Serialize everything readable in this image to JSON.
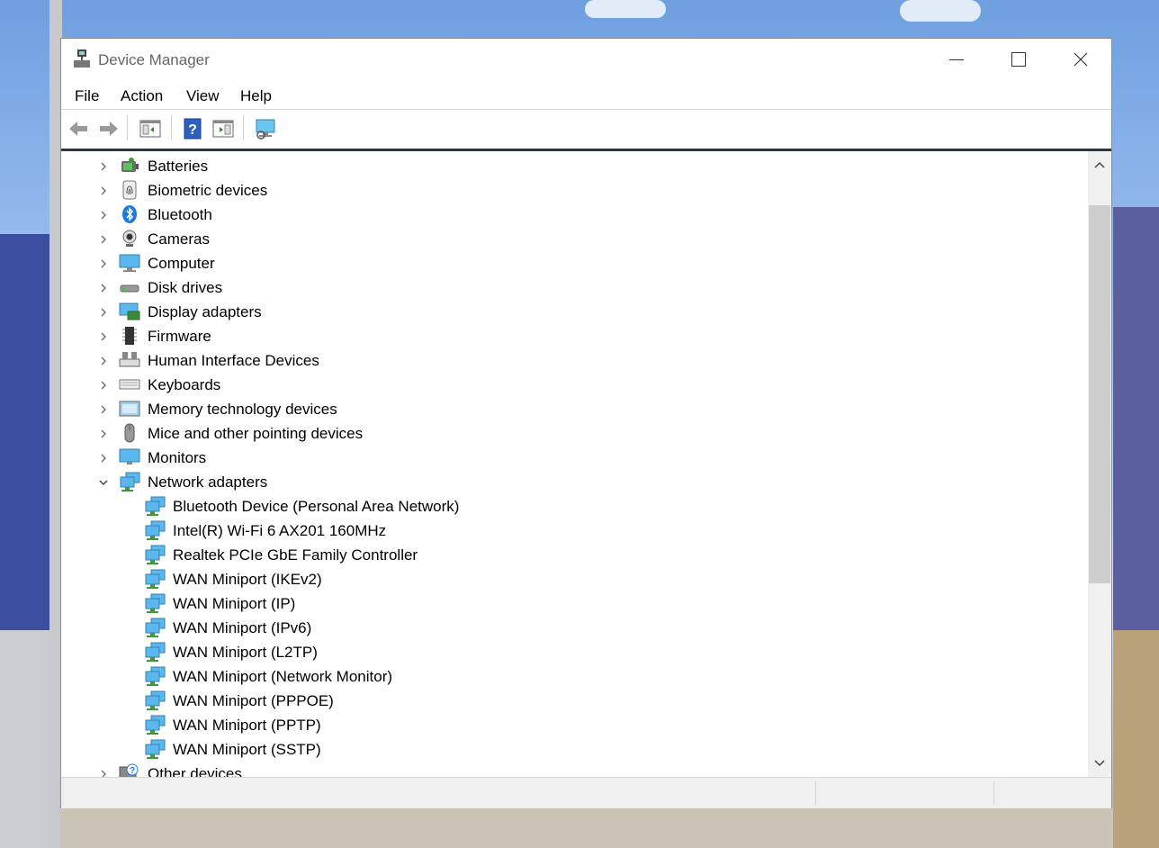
{
  "window": {
    "title": "Device Manager"
  },
  "menu": [
    "File",
    "Action",
    "View",
    "Help"
  ],
  "toolbar": [
    "back-arrow-icon",
    "forward-arrow-icon",
    "show-hide-console-tree-icon",
    "help-icon",
    "action-pane-icon",
    "scan-hardware-monitor-icon"
  ],
  "tree": [
    {
      "label": "Batteries",
      "icon": "battery-icon",
      "expanded": false,
      "level": 0
    },
    {
      "label": "Biometric devices",
      "icon": "fingerprint-icon",
      "expanded": false,
      "level": 0
    },
    {
      "label": "Bluetooth",
      "icon": "bluetooth-icon",
      "expanded": false,
      "level": 0
    },
    {
      "label": "Cameras",
      "icon": "camera-icon",
      "expanded": false,
      "level": 0
    },
    {
      "label": "Computer",
      "icon": "computer-icon",
      "expanded": false,
      "level": 0
    },
    {
      "label": "Disk drives",
      "icon": "disk-drive-icon",
      "expanded": false,
      "level": 0
    },
    {
      "label": "Display adapters",
      "icon": "display-adapter-icon",
      "expanded": false,
      "level": 0
    },
    {
      "label": "Firmware",
      "icon": "firmware-icon",
      "expanded": false,
      "level": 0
    },
    {
      "label": "Human Interface Devices",
      "icon": "hid-icon",
      "expanded": false,
      "level": 0
    },
    {
      "label": "Keyboards",
      "icon": "keyboard-icon",
      "expanded": false,
      "level": 0
    },
    {
      "label": "Memory technology devices",
      "icon": "memory-icon",
      "expanded": false,
      "level": 0
    },
    {
      "label": "Mice and other pointing devices",
      "icon": "mouse-icon",
      "expanded": false,
      "level": 0
    },
    {
      "label": "Monitors",
      "icon": "monitor-icon",
      "expanded": false,
      "level": 0
    },
    {
      "label": "Network adapters",
      "icon": "network-adapter-icon",
      "expanded": true,
      "level": 0
    },
    {
      "label": "Bluetooth Device (Personal Area Network)",
      "icon": "network-adapter-icon",
      "level": 1
    },
    {
      "label": "Intel(R) Wi-Fi 6 AX201 160MHz",
      "icon": "network-adapter-icon",
      "level": 1
    },
    {
      "label": "Realtek PCIe GbE Family Controller",
      "icon": "network-adapter-icon",
      "level": 1
    },
    {
      "label": "WAN Miniport (IKEv2)",
      "icon": "network-adapter-icon",
      "level": 1
    },
    {
      "label": "WAN Miniport (IP)",
      "icon": "network-adapter-icon",
      "level": 1
    },
    {
      "label": "WAN Miniport (IPv6)",
      "icon": "network-adapter-icon",
      "level": 1
    },
    {
      "label": "WAN Miniport (L2TP)",
      "icon": "network-adapter-icon",
      "level": 1
    },
    {
      "label": "WAN Miniport (Network Monitor)",
      "icon": "network-adapter-icon",
      "level": 1
    },
    {
      "label": "WAN Miniport (PPPOE)",
      "icon": "network-adapter-icon",
      "level": 1
    },
    {
      "label": "WAN Miniport (PPTP)",
      "icon": "network-adapter-icon",
      "level": 1
    },
    {
      "label": "WAN Miniport (SSTP)",
      "icon": "network-adapter-icon",
      "level": 1
    },
    {
      "label": "Other devices",
      "icon": "unknown-device-icon",
      "expanded": false,
      "level": 0
    }
  ]
}
